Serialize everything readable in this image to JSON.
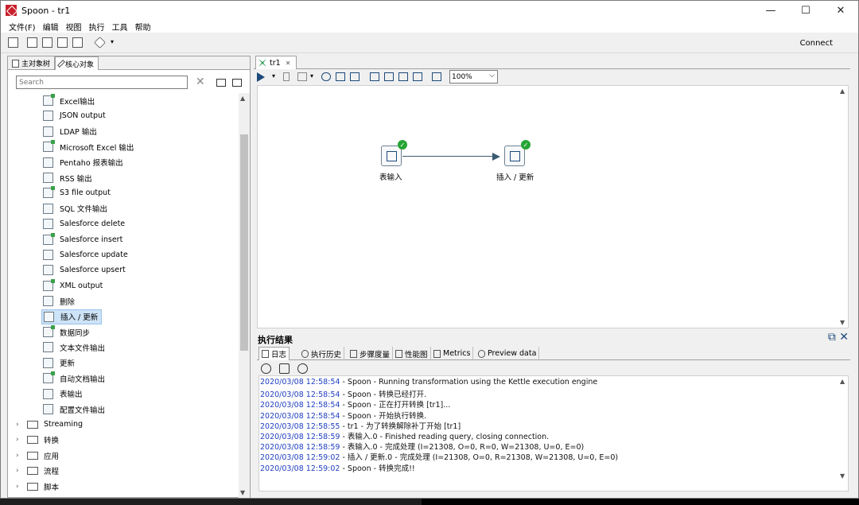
{
  "window": {
    "title": "Spoon - tr1",
    "controls": [
      "—",
      "☐",
      "✕"
    ]
  },
  "menu": [
    "文件(F)",
    "编辑",
    "视图",
    "执行",
    "工具",
    "帮助"
  ],
  "toolbar": {
    "connect_label": "Connect"
  },
  "left": {
    "tabs": [
      "主对象树",
      "核心对象"
    ],
    "search_placeholder": "Search",
    "steps": [
      "Excel输出",
      "JSON output",
      "LDAP 输出",
      "Microsoft Excel 输出",
      "Pentaho 报表输出",
      "RSS 输出",
      "S3 file output",
      "SQL 文件输出",
      "Salesforce delete",
      "Salesforce insert",
      "Salesforce update",
      "Salesforce upsert",
      "XML output",
      "删除",
      "插入 / 更新",
      "数据同步",
      "文本文件输出",
      "更新",
      "自动文档输出",
      "表输出",
      "配置文件输出"
    ],
    "selected_step": "插入 / 更新",
    "folders": [
      "Streaming",
      "转换",
      "应用",
      "流程",
      "脚本"
    ]
  },
  "editor": {
    "tab_label": "tr1",
    "zoom": "100%",
    "nodes": [
      {
        "label": "表输入",
        "status": "success"
      },
      {
        "label": "插入 / 更新",
        "status": "success"
      }
    ]
  },
  "results": {
    "title": "执行结果",
    "tabs": [
      "日志",
      "执行历史",
      "步骤度量",
      "性能图",
      "Metrics",
      "Preview data"
    ],
    "log": [
      {
        "ts": "2020/03/08 12:58:54",
        "msg": " - Spoon - Running transformation using the Kettle execution engine"
      },
      {
        "ts": "2020/03/08 12:58:54",
        "msg": " - Spoon - 转换已经打开."
      },
      {
        "ts": "2020/03/08 12:58:54",
        "msg": " - Spoon - 正在打开转换 [tr1]..."
      },
      {
        "ts": "2020/03/08 12:58:54",
        "msg": " - Spoon - 开始执行转换."
      },
      {
        "ts": "2020/03/08 12:58:55",
        "msg": " - tr1 - 为了转换解除补丁开始  [tr1]"
      },
      {
        "ts": "2020/03/08 12:58:59",
        "msg": " - 表输入.0 - Finished reading query, closing connection."
      },
      {
        "ts": "2020/03/08 12:58:59",
        "msg": " - 表输入.0 - 完成处理 (I=21308, O=0, R=0, W=21308, U=0, E=0)"
      },
      {
        "ts": "2020/03/08 12:59:02",
        "msg": " - 插入 / 更新.0 - 完成处理 (I=21308, O=0, R=21308, W=21308, U=0, E=0)"
      },
      {
        "ts": "2020/03/08 12:59:02",
        "msg": " - Spoon - 转换完成!!"
      }
    ]
  },
  "colors": {
    "timestamp": "#1f3fbf",
    "success": "#26a534",
    "selection": "#cde3f7",
    "app_icon": "#c8202c"
  }
}
